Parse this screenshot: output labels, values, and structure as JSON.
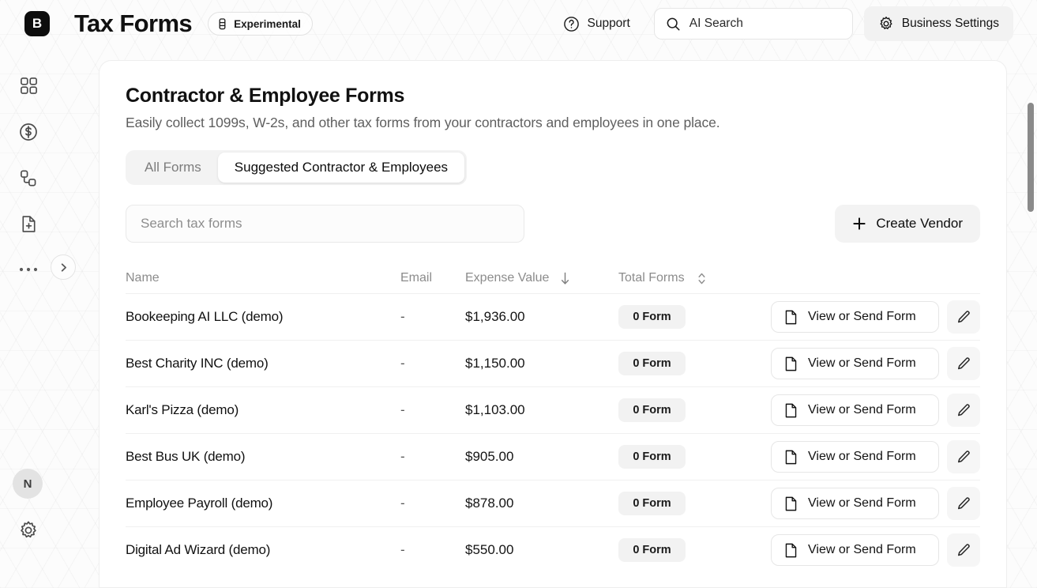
{
  "topbar": {
    "logo_letter": "B",
    "app_title": "Tax Forms",
    "experimental_label": "Experimental",
    "support_label": "Support",
    "ai_search_placeholder": "AI Search",
    "business_settings_label": "Business Settings"
  },
  "sidebar": {
    "items": [
      {
        "name": "dashboard-grid-icon"
      },
      {
        "name": "dollar-circle-icon"
      },
      {
        "name": "workflow-nodes-icon"
      },
      {
        "name": "document-plus-icon"
      },
      {
        "name": "more-ellipsis-icon"
      }
    ],
    "avatar_initial": "N",
    "settings_icon": "gear-icon",
    "expand_icon": "chevron-right-icon"
  },
  "main": {
    "title": "Contractor & Employee Forms",
    "subtitle": "Easily collect 1099s, W-2s, and other tax forms from your contractors and employees in one place.",
    "tabs": [
      {
        "label": "All Forms",
        "active": false
      },
      {
        "label": "Suggested Contractor & Employees",
        "active": true
      }
    ],
    "search_placeholder": "Search tax forms",
    "create_button": "Create Vendor",
    "columns": {
      "name": "Name",
      "email": "Email",
      "expense_value": "Expense Value",
      "total_forms": "Total Forms",
      "expense_sort": "descending",
      "total_forms_sort": "none"
    },
    "row_action_label": "View or Send Form",
    "rows": [
      {
        "name": "Bookeeping AI LLC (demo)",
        "email": "-",
        "expense": "$1,936.00",
        "forms": "0 Form",
        "action": "View or Send Form"
      },
      {
        "name": "Best Charity INC (demo)",
        "email": "-",
        "expense": "$1,150.00",
        "forms": "0 Form",
        "action": "View or Send Form"
      },
      {
        "name": "Karl's Pizza (demo)",
        "email": "-",
        "expense": "$1,103.00",
        "forms": "0 Form",
        "action": "View or Send Form"
      },
      {
        "name": "Best Bus UK (demo)",
        "email": "-",
        "expense": "$905.00",
        "forms": "0 Form",
        "action": "View or Send Form"
      },
      {
        "name": "Employee Payroll (demo)",
        "email": "-",
        "expense": "$878.00",
        "forms": "0 Form",
        "action": "View or Send Form"
      },
      {
        "name": "Digital Ad Wizard (demo)",
        "email": "-",
        "expense": "$550.00",
        "forms": "0 Form",
        "action": "View or Send Form"
      }
    ]
  },
  "colors": {
    "accent": "#0d0d0d",
    "surface": "#ffffff",
    "muted": "#8c8c8c",
    "chip": "#f2f2f2"
  }
}
